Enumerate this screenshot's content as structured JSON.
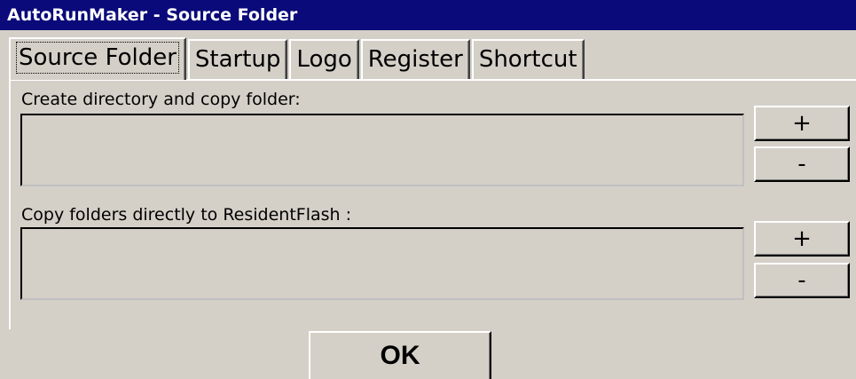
{
  "window": {
    "title": "AutoRunMaker - Source Folder"
  },
  "tabs": [
    {
      "label": "Source Folder",
      "active": true
    },
    {
      "label": "Startup",
      "active": false
    },
    {
      "label": "Logo",
      "active": false
    },
    {
      "label": "Register",
      "active": false
    },
    {
      "label": "Shortcut",
      "active": false
    }
  ],
  "section_create": {
    "label": "Create directory and copy folder:",
    "add_label": "+",
    "remove_label": "-"
  },
  "section_copy": {
    "label": "Copy folders directly to ResidentFlash :",
    "add_label": "+",
    "remove_label": "-"
  },
  "ok_label": "OK",
  "colors": {
    "titlebar": "#0a0a7a",
    "face": "#d4d0c8"
  }
}
